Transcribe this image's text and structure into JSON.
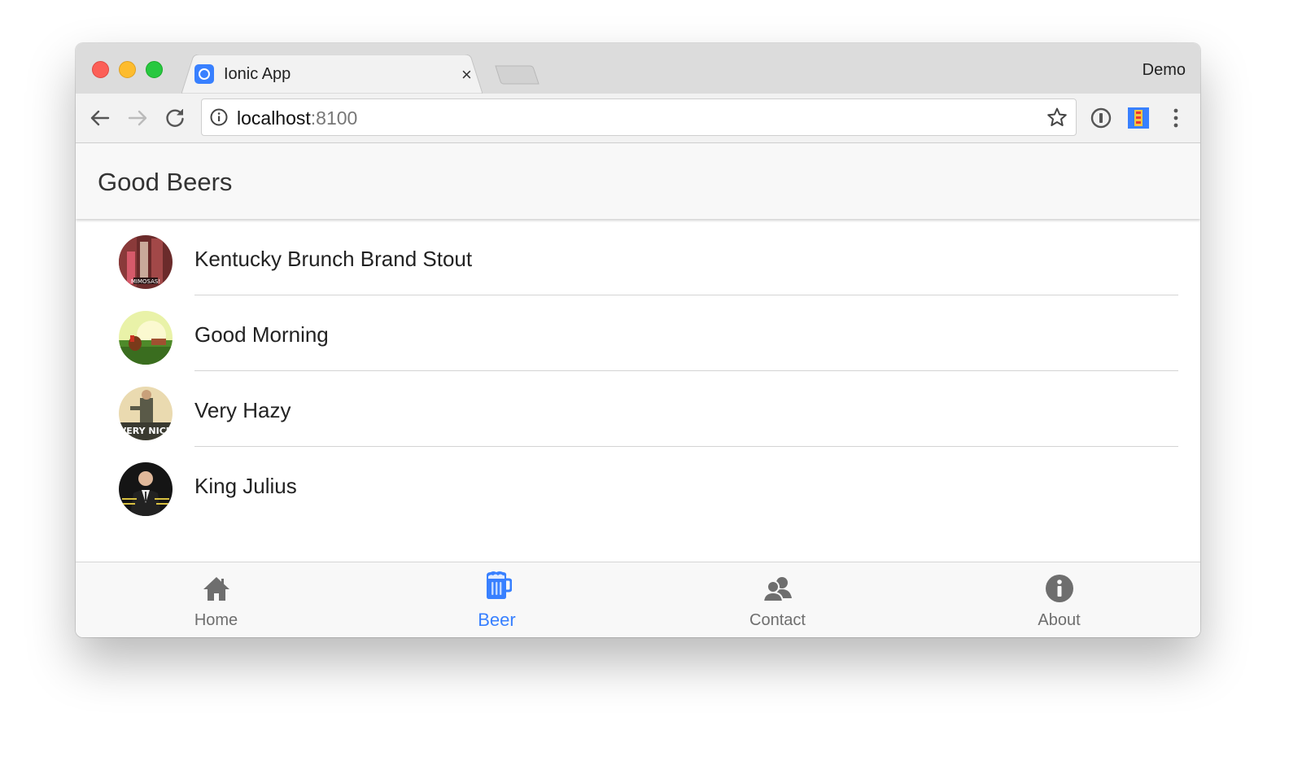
{
  "browser": {
    "tab": {
      "title": "Ionic App",
      "close_glyph": "×",
      "favicon": "ionic-logo-icon"
    },
    "profile_name": "Demo",
    "address": {
      "host": "localhost",
      "port": ":8100"
    },
    "colors": {
      "close": "#fc5f57",
      "minimize": "#fdbc2e",
      "maximize": "#28c840"
    }
  },
  "app": {
    "header": {
      "title": "Good Beers"
    },
    "list": {
      "items": [
        {
          "label": "Kentucky Brunch Brand Stout",
          "avatar_caption": "MIMOSAS!"
        },
        {
          "label": "Good Morning"
        },
        {
          "label": "Very Hazy",
          "avatar_caption": "VERY NICE"
        },
        {
          "label": "King Julius"
        }
      ]
    },
    "tabs": [
      {
        "label": "Home",
        "icon": "home-icon",
        "active": false
      },
      {
        "label": "Beer",
        "icon": "beer-icon",
        "active": true
      },
      {
        "label": "Contact",
        "icon": "contacts-icon",
        "active": false
      },
      {
        "label": "About",
        "icon": "info-icon",
        "active": false
      }
    ],
    "colors": {
      "primary": "#3880ff",
      "tab_inactive": "#6e6e6e"
    }
  }
}
